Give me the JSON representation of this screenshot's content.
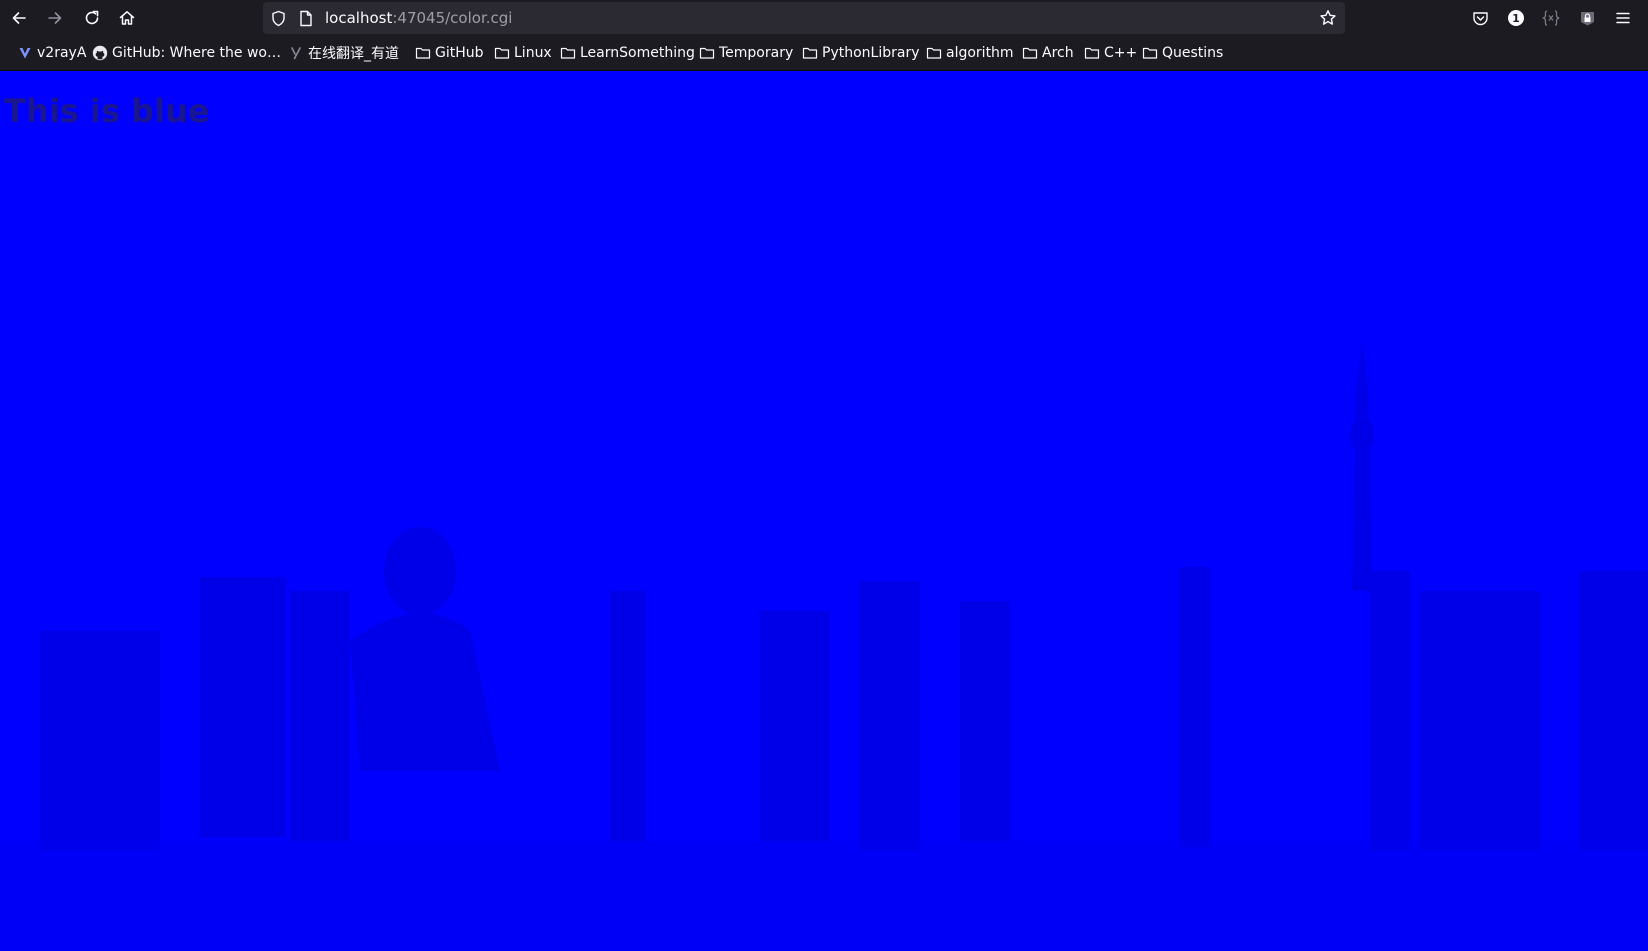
{
  "colors": {
    "page_background": "#0000ff",
    "heading_text": "#1a1590",
    "toolbar": "#1c1b22",
    "urlbar": "#2b2a33"
  },
  "toolbar": {
    "back_icon": "arrow-left-icon",
    "forward_icon": "arrow-right-icon",
    "reload_icon": "reload-icon",
    "home_icon": "home-icon",
    "url_host": "localhost",
    "url_rest": ":47045/color.cgi",
    "bookmark_star_icon": "star-icon",
    "right_icons": [
      "pocket-icon",
      "password-manager-icon",
      "json-viewer-icon",
      "extension-lock-icon",
      "menu-icon"
    ],
    "password_manager_badge": "1"
  },
  "bookmarks": [
    {
      "label": "v2rayA",
      "icon": "v2raya-icon"
    },
    {
      "label": "GitHub: Where the wo…",
      "icon": "github-icon"
    },
    {
      "label": "在线翻译_有道",
      "icon": "youdao-icon"
    },
    {
      "label": "GitHub",
      "icon": "folder-icon"
    },
    {
      "label": "Linux",
      "icon": "folder-icon"
    },
    {
      "label": "LearnSomething",
      "icon": "folder-icon"
    },
    {
      "label": "Temporary",
      "icon": "folder-icon"
    },
    {
      "label": "PythonLibrary",
      "icon": "folder-icon"
    },
    {
      "label": "algorithm",
      "icon": "folder-icon"
    },
    {
      "label": "Arch",
      "icon": "folder-icon"
    },
    {
      "label": "C++",
      "icon": "folder-icon"
    },
    {
      "label": "Questins",
      "icon": "folder-icon"
    }
  ],
  "page": {
    "heading": "This is blue"
  }
}
